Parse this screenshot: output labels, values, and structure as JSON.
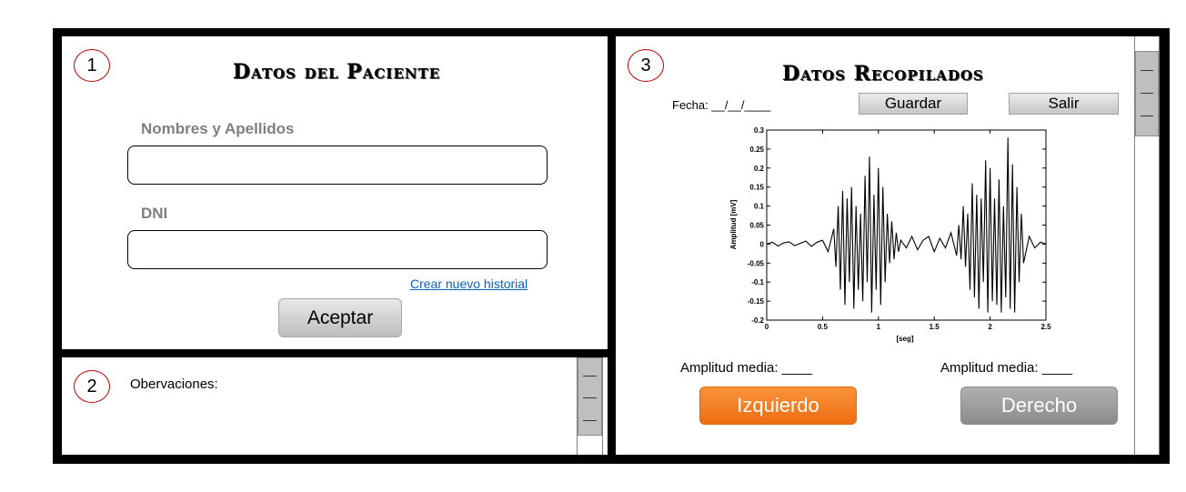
{
  "panel1": {
    "number": "1",
    "title": "Datos del Paciente",
    "name_label": "Nombres y Apellidos",
    "name_value": "",
    "dni_label": "DNI",
    "dni_value": "",
    "new_record_link": "Crear nuevo historial",
    "accept_button": "Aceptar"
  },
  "panel2": {
    "number": "2",
    "observations_label": "Obervaciones:"
  },
  "panel3": {
    "number": "3",
    "title": "Datos Recopilados",
    "date_label": "Fecha: __/__/____",
    "save_button": "Guardar",
    "exit_button": "Salir",
    "left_amplitude": "Amplitud media: ____",
    "right_amplitude": "Amplitud media: ____",
    "left_button": "Izquierdo",
    "right_button": "Derecho"
  },
  "colors": {
    "accent_orange": "#f07d22",
    "circle_red": "#c00000",
    "link_blue": "#0563c1"
  },
  "chart_data": {
    "type": "line",
    "title": "",
    "xlabel": "[seg]",
    "ylabel": "Amplitud [mV]",
    "xlim": [
      0,
      2.5
    ],
    "ylim": [
      -0.2,
      0.3
    ],
    "xticks": [
      "0",
      "0.5",
      "1",
      "1.5",
      "2",
      "2.5"
    ],
    "yticks": [
      "-0.2",
      "-0.15",
      "-0.1",
      "-0.05",
      "0",
      "0.05",
      "0.1",
      "0.15",
      "0.2",
      "0.25",
      "0.3"
    ],
    "grid": false,
    "series": [
      {
        "x": [
          0,
          0.05,
          0.1,
          0.15,
          0.2,
          0.25,
          0.3,
          0.35,
          0.4,
          0.45,
          0.5,
          0.55,
          0.6,
          0.62,
          0.64,
          0.66,
          0.68,
          0.7,
          0.72,
          0.74,
          0.76,
          0.78,
          0.8,
          0.82,
          0.84,
          0.86,
          0.88,
          0.9,
          0.92,
          0.94,
          0.96,
          0.98,
          1.0,
          1.02,
          1.04,
          1.06,
          1.08,
          1.1,
          1.12,
          1.14,
          1.16,
          1.18,
          1.2,
          1.25,
          1.3,
          1.35,
          1.4,
          1.45,
          1.5,
          1.55,
          1.6,
          1.65,
          1.7,
          1.72,
          1.74,
          1.76,
          1.78,
          1.8,
          1.82,
          1.84,
          1.86,
          1.88,
          1.9,
          1.92,
          1.94,
          1.96,
          1.98,
          2.0,
          2.02,
          2.04,
          2.06,
          2.08,
          2.1,
          2.12,
          2.14,
          2.16,
          2.18,
          2.2,
          2.22,
          2.24,
          2.26,
          2.28,
          2.3,
          2.35,
          2.4,
          2.45,
          2.5
        ],
        "values": [
          0,
          0.005,
          -0.005,
          0.003,
          0.006,
          -0.004,
          0.002,
          0.008,
          -0.006,
          0.005,
          0.01,
          -0.02,
          0.04,
          -0.06,
          0.1,
          -0.12,
          0.14,
          -0.16,
          0.12,
          -0.1,
          0.15,
          -0.17,
          0.1,
          -0.12,
          0.08,
          -0.15,
          0.18,
          -0.1,
          0.23,
          -0.18,
          0.13,
          -0.12,
          0.2,
          -0.16,
          0.15,
          -0.1,
          0.08,
          -0.05,
          0.06,
          -0.04,
          0.03,
          -0.02,
          0.01,
          -0.01,
          0.02,
          -0.015,
          0.01,
          0.02,
          -0.02,
          0.015,
          -0.01,
          0.03,
          -0.03,
          0.05,
          -0.04,
          0.1,
          -0.06,
          0.08,
          -0.12,
          0.16,
          -0.14,
          0.13,
          -0.17,
          0.12,
          -0.1,
          0.22,
          -0.18,
          0.2,
          -0.15,
          0.12,
          -0.16,
          0.17,
          -0.18,
          0.1,
          -0.14,
          0.28,
          -0.17,
          0.21,
          -0.18,
          0.15,
          -0.1,
          0.08,
          -0.05,
          0.02,
          -0.01,
          0.005,
          0
        ]
      }
    ]
  }
}
